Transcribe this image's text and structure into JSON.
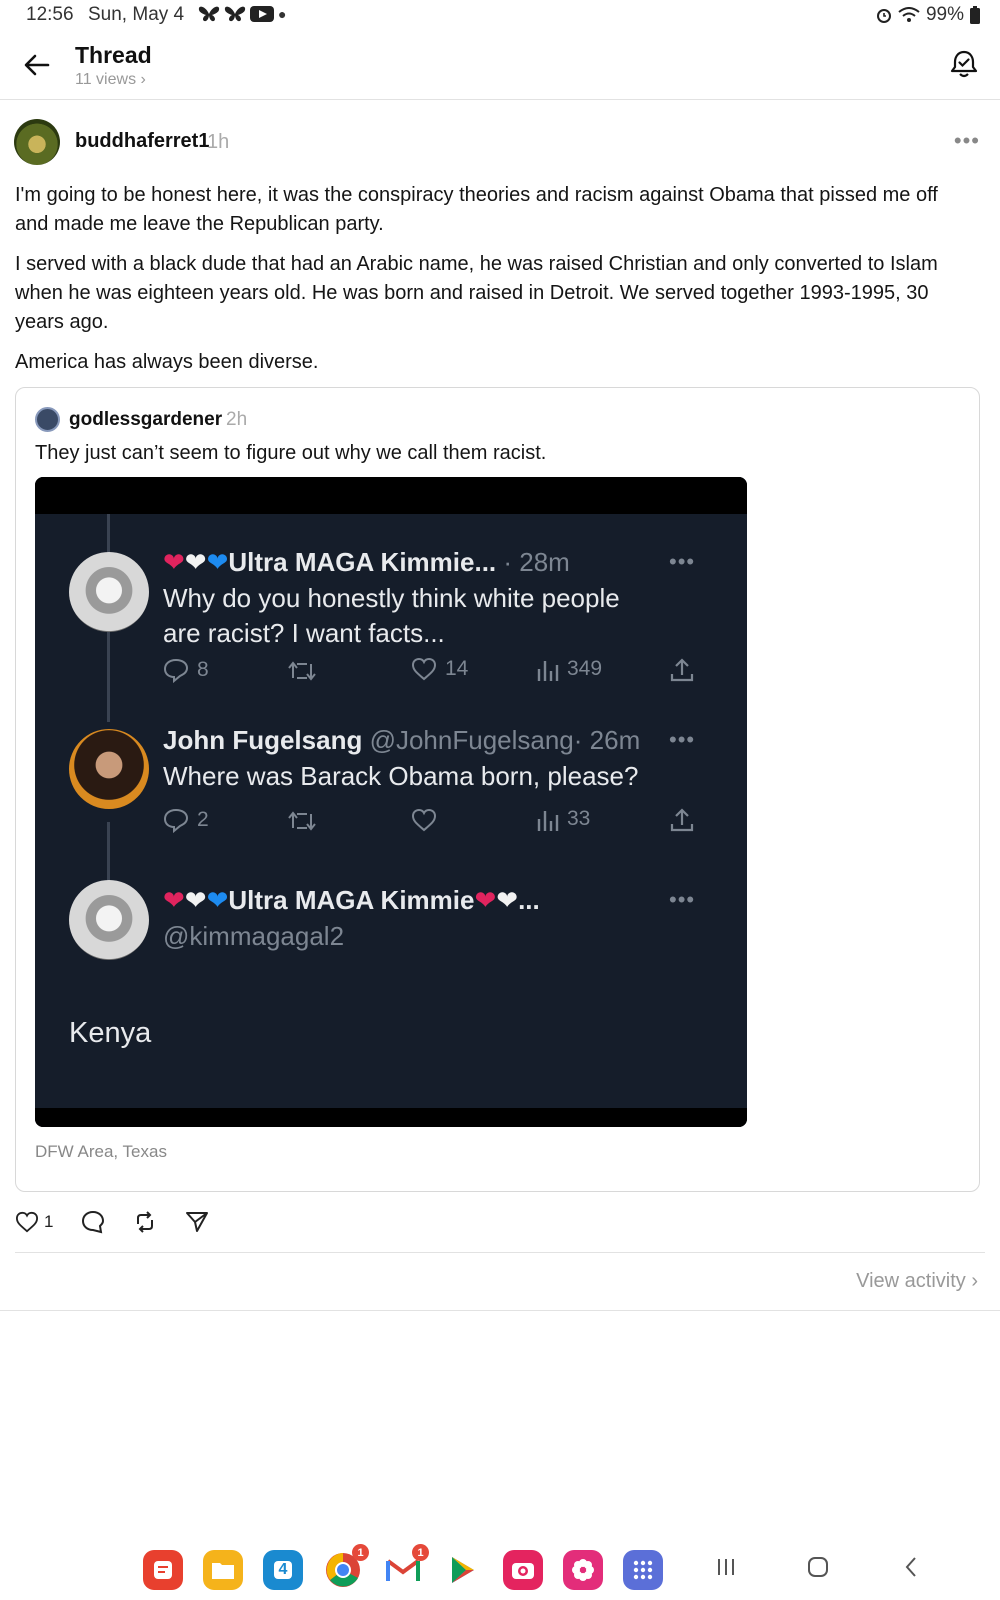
{
  "status_bar": {
    "time": "12:56",
    "date": "Sun, May 4",
    "battery": "99%"
  },
  "header": {
    "title": "Thread",
    "views": "11 views"
  },
  "post": {
    "username": "buddhaferret1",
    "time": "1h",
    "paragraphs": [
      "I'm going to be honest here, it was the conspiracy theories and racism against Obama that pissed me off and made me leave the Republican party.",
      "I served with a black dude that had an Arabic name, he was raised Christian and only converted to Islam when he was eighteen years old. He was born and raised in Detroit. We served together 1993-1995, 30 years ago.",
      "America has always been diverse."
    ],
    "like_count": "1"
  },
  "quote": {
    "username": "godlessgardener",
    "time": "2h",
    "text": "They just can’t seem to figure out why we call them racist.",
    "location": "DFW Area, Texas",
    "embedded": {
      "tweet1": {
        "name": "Ultra MAGA Kimmie...",
        "time": "· 28m",
        "line1": "Why do you honestly think white people",
        "line2": "are racist? I want facts...",
        "replies": "8",
        "likes": "14",
        "views": "349"
      },
      "tweet2": {
        "name": "John Fugelsang",
        "handle": "@JohnFugelsang",
        "time": "· 26m",
        "text": "Where was Barack Obama born, please?",
        "replies": "2",
        "views": "33"
      },
      "tweet3": {
        "name": "Ultra MAGA Kimmie",
        "ellipsis": "...",
        "handle": "@kimmagagal2",
        "text": "Kenya"
      }
    }
  },
  "footer": {
    "view_activity": "View activity"
  },
  "nav": {
    "calendar_day": "4",
    "chrome_badge": "1",
    "gmail_badge": "1"
  },
  "colors": {
    "tweet_bg": "#151d2a",
    "heart_red": "#e0245e",
    "heart_blue": "#1d8bf0"
  }
}
